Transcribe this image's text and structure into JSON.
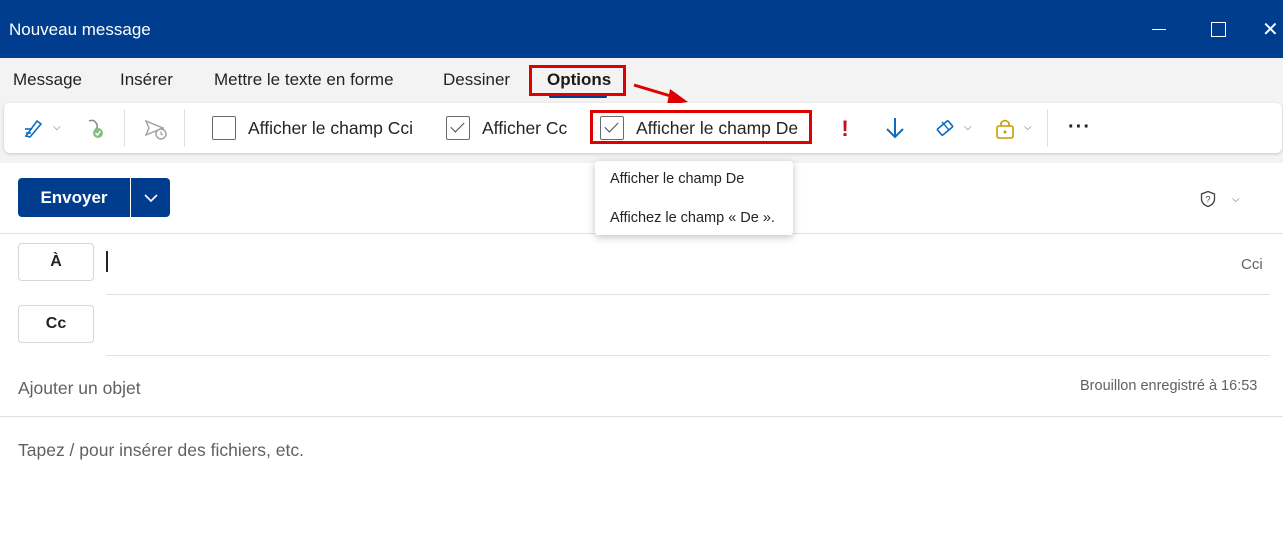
{
  "window": {
    "title": "Nouveau message",
    "close_glyph": "✕"
  },
  "tabs": [
    {
      "label": "Message"
    },
    {
      "label": "Insérer"
    },
    {
      "label": "Mettre le texte en forme"
    },
    {
      "label": "Dessiner"
    },
    {
      "label": "Options",
      "selected": true
    }
  ],
  "toolbar": {
    "icons": [
      "themes-pen-icon",
      "sensitivity-icon",
      "delay-send-icon",
      "high-importance-icon",
      "low-importance-icon",
      "tracking-icon",
      "encrypt-lock-icon"
    ],
    "checkboxes": [
      {
        "label": "Afficher le champ Cci",
        "checked": false
      },
      {
        "label": "Afficher Cc",
        "checked": true
      },
      {
        "label": "Afficher le champ De",
        "checked": true
      }
    ],
    "more_label": "···",
    "importance_high_glyph": "!"
  },
  "tooltip": {
    "title": "Afficher le champ De",
    "description": "Affichez le champ « De »."
  },
  "compose": {
    "send_label": "Envoyer",
    "to_label": "À",
    "cc_label": "Cc",
    "bcc_link": "Cci",
    "subject_placeholder": "Ajouter un objet",
    "draft_status": "Brouillon enregistré à 16:53",
    "body_placeholder": "Tapez / pour insérer des fichiers, etc."
  },
  "colors": {
    "brand": "#003d8f",
    "highlight": "#e00000",
    "accent_blue": "#0f6cbd",
    "importance_red": "#c50f1f",
    "gold": "#c19c00"
  }
}
